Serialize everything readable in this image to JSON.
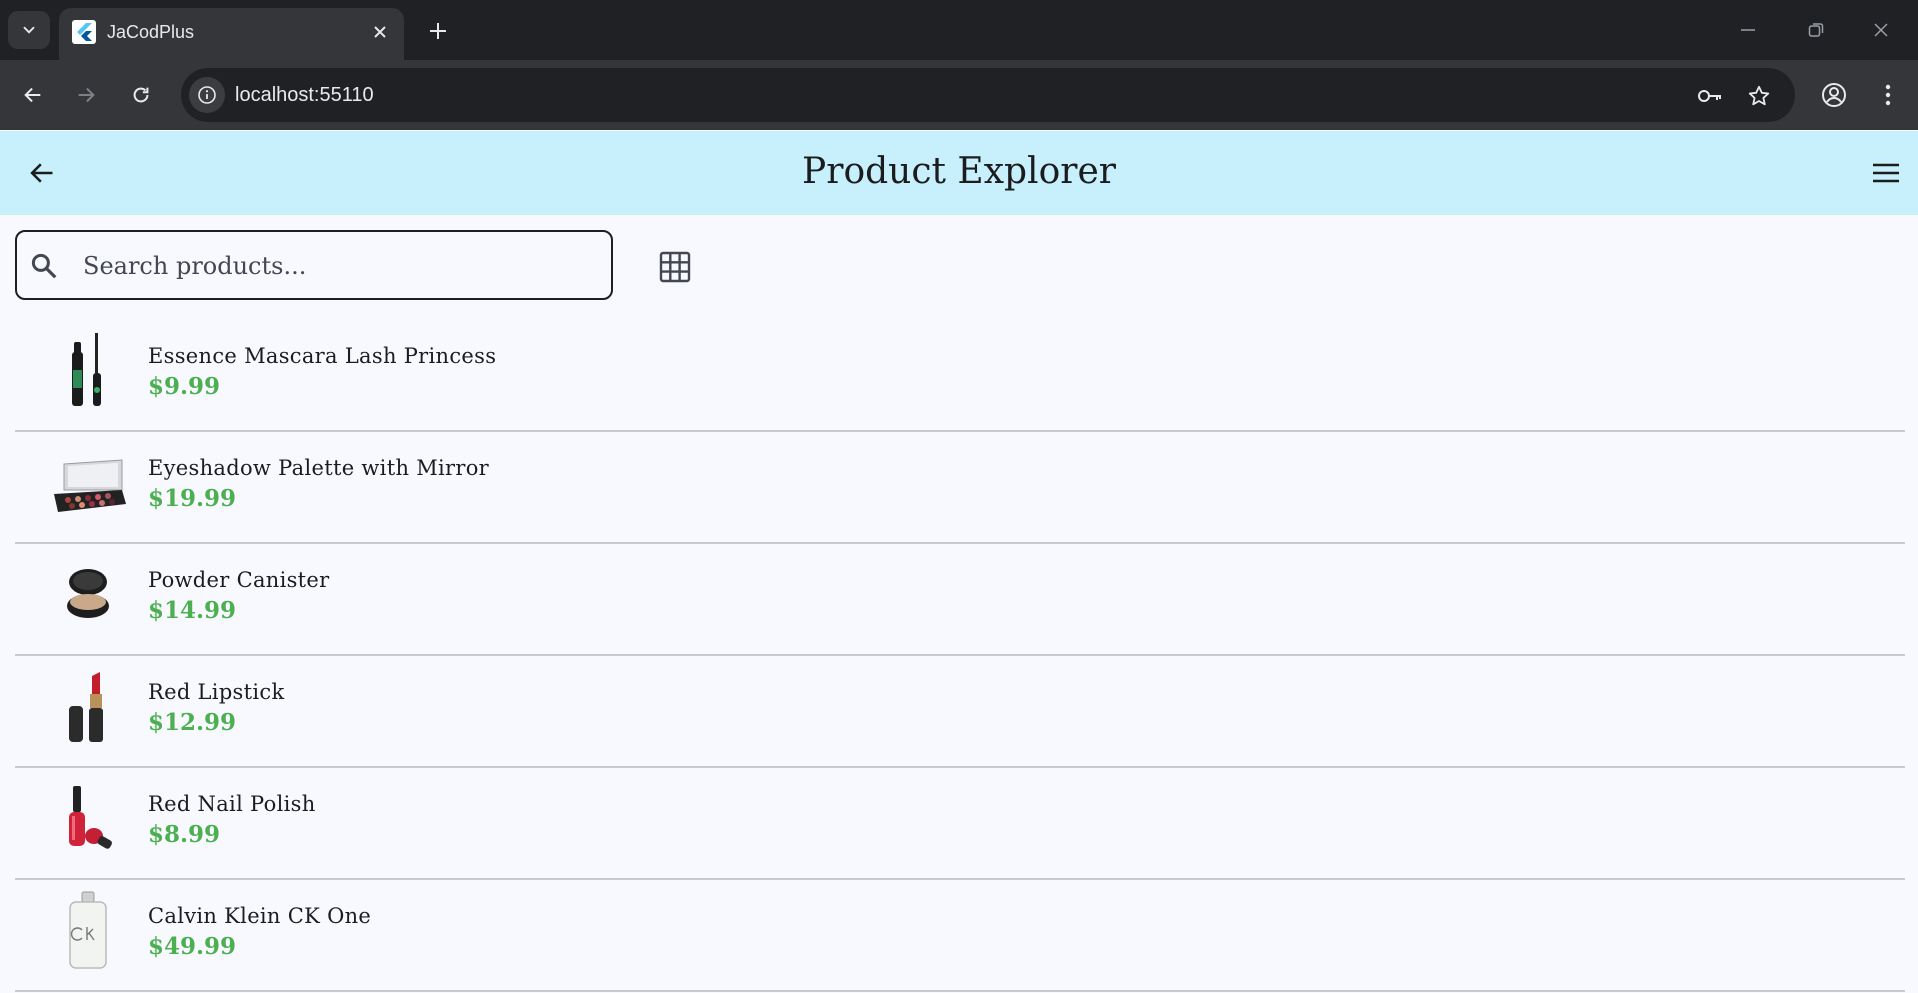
{
  "browser": {
    "tab_title": "JaCodPlus",
    "url": "localhost:55110"
  },
  "app": {
    "title": "Product Explorer"
  },
  "search": {
    "placeholder": "Search products..."
  },
  "products": [
    {
      "name": "Essence Mascara Lash Princess",
      "price": "$9.99"
    },
    {
      "name": "Eyeshadow Palette with Mirror",
      "price": "$19.99"
    },
    {
      "name": "Powder Canister",
      "price": "$14.99"
    },
    {
      "name": "Red Lipstick",
      "price": "$12.99"
    },
    {
      "name": "Red Nail Polish",
      "price": "$8.99"
    },
    {
      "name": "Calvin Klein CK One",
      "price": "$49.99"
    }
  ],
  "colors": {
    "appbar_bg": "#c8f0fc",
    "page_bg": "#f7f9ff",
    "price": "#4caf50"
  }
}
